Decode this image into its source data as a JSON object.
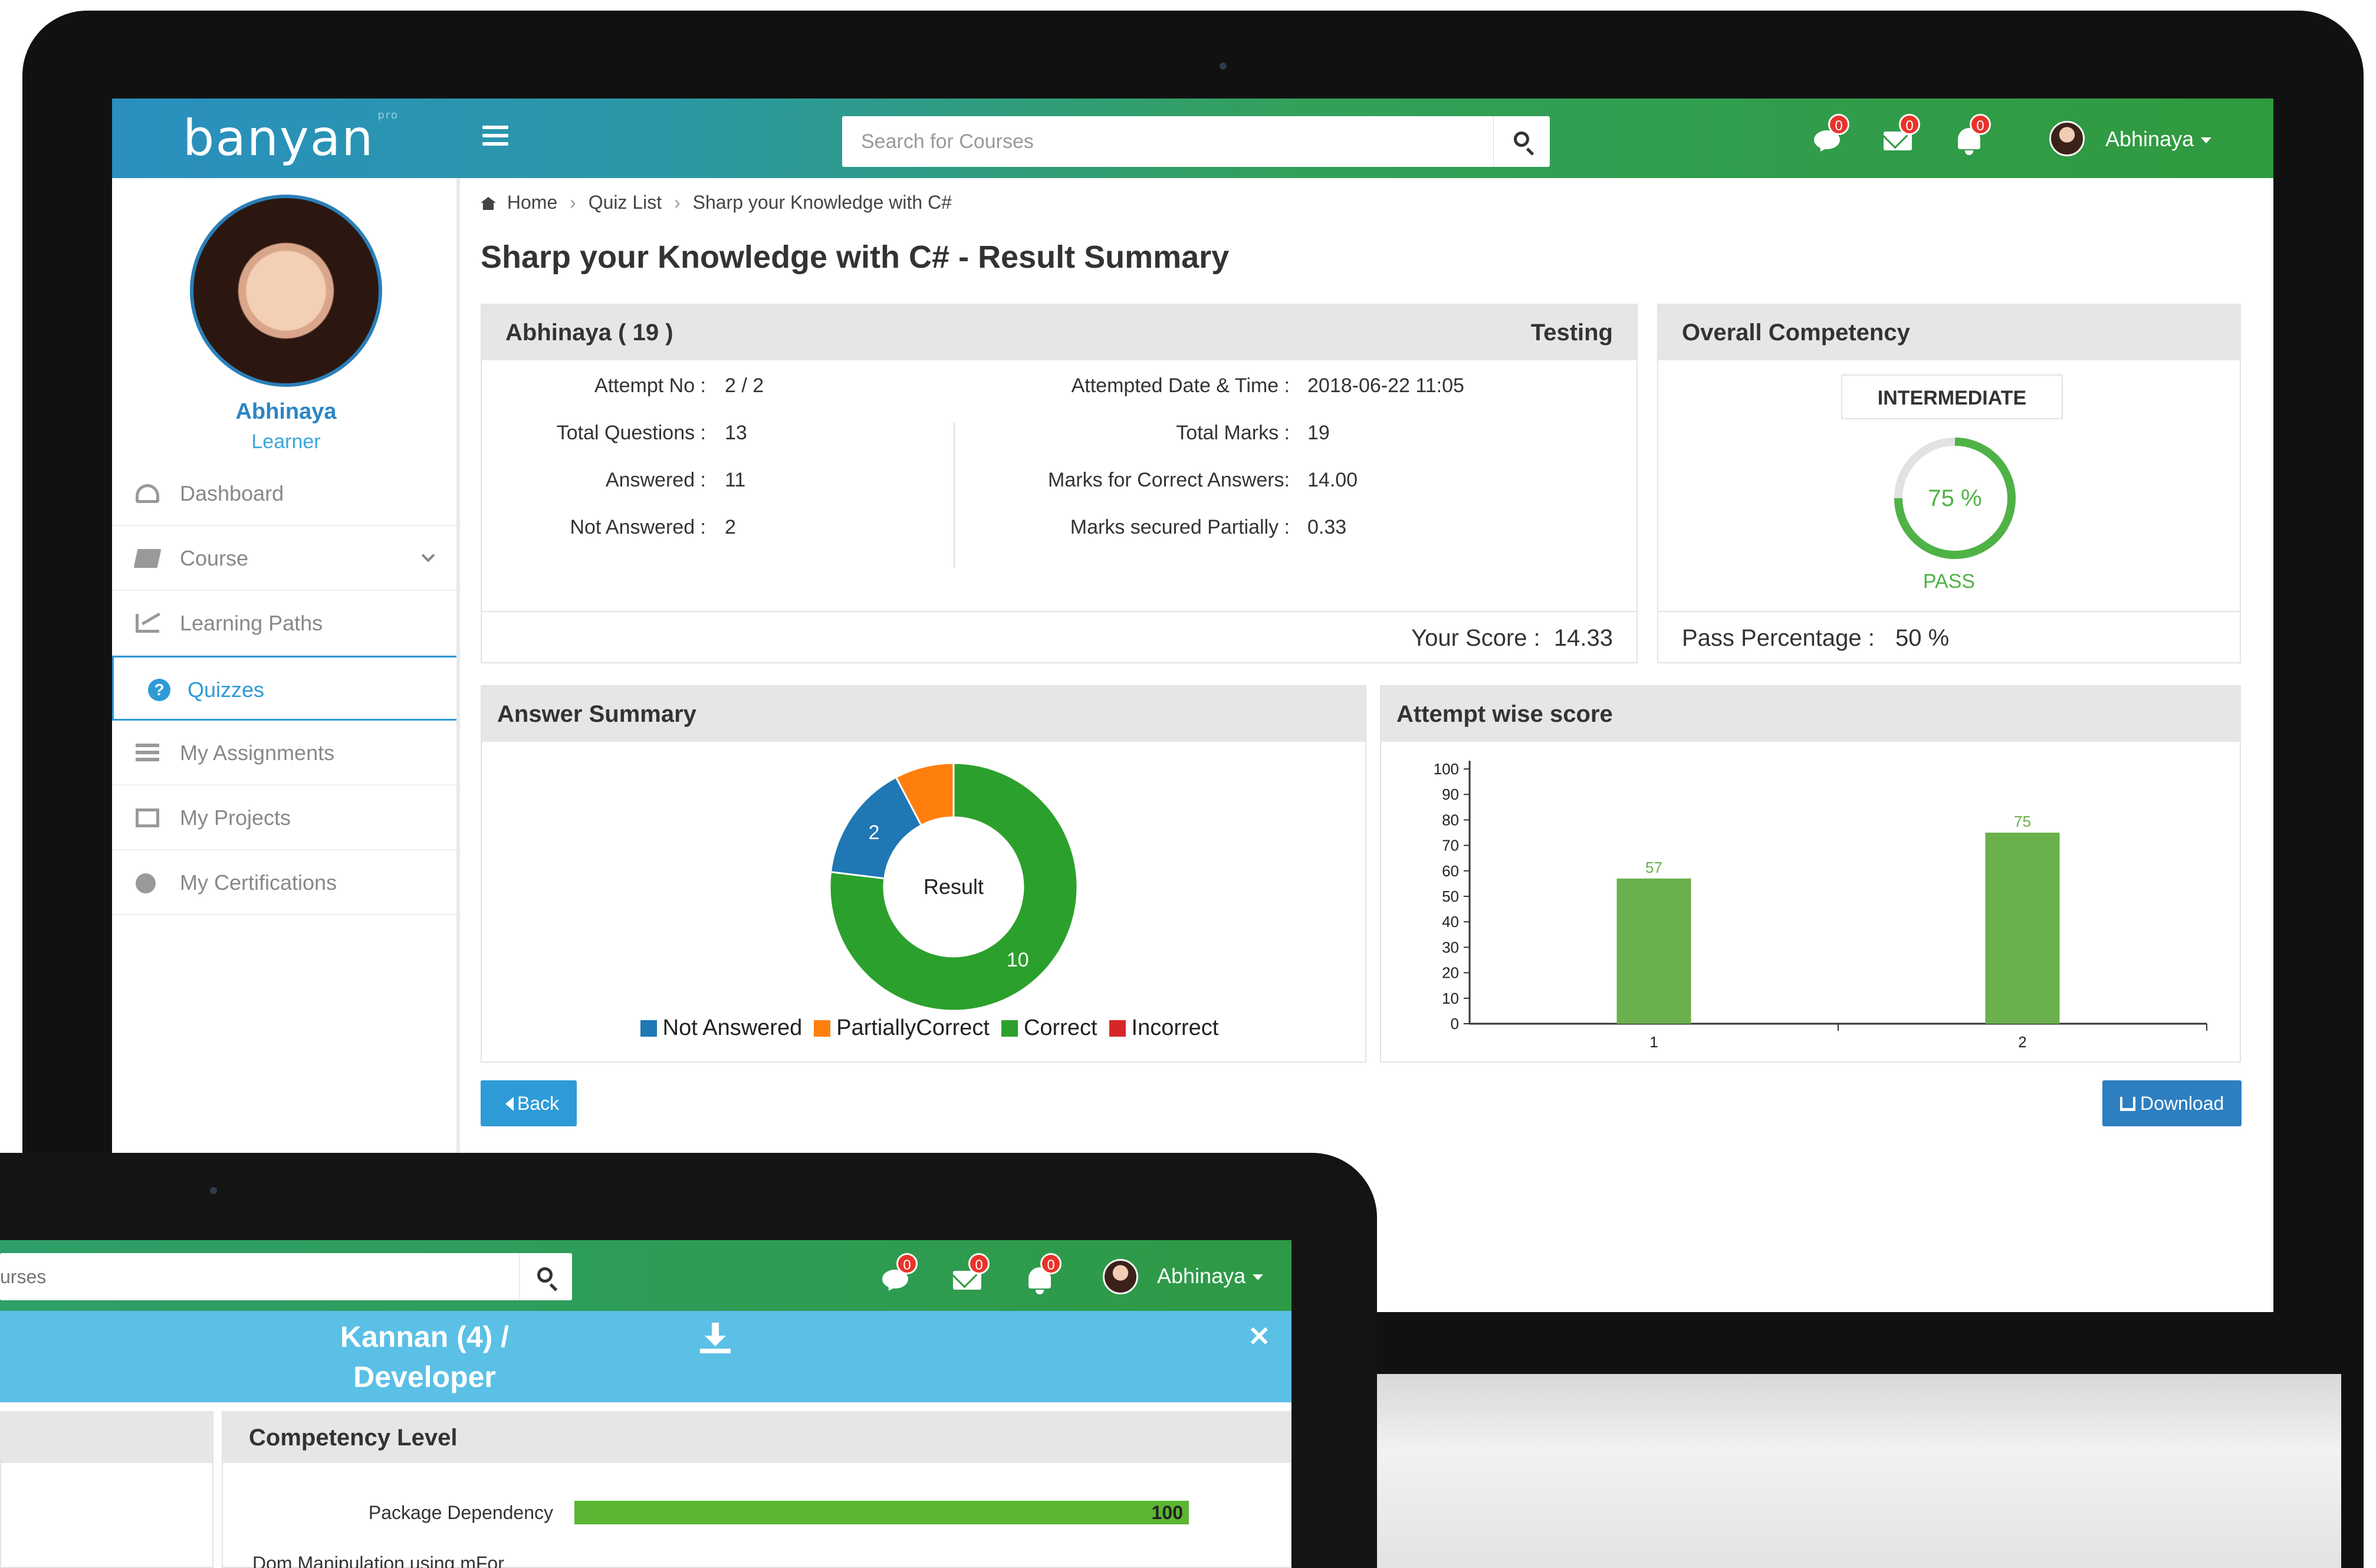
{
  "header": {
    "logo_text": "banyan",
    "logo_suffix": "pro",
    "search_placeholder": "Search for Courses",
    "notifications": [
      {
        "icon": "chat-icon",
        "count": "0"
      },
      {
        "icon": "mail-icon",
        "count": "0"
      },
      {
        "icon": "bell-icon",
        "count": "0"
      }
    ],
    "user_name": "Abhinaya"
  },
  "sidebar": {
    "profile_name": "Abhinaya",
    "profile_role": "Learner",
    "items": [
      {
        "label": "Dashboard",
        "icon": "dashboard-icon"
      },
      {
        "label": "Course",
        "icon": "book-icon"
      },
      {
        "label": "Learning Paths",
        "icon": "line-chart-icon"
      },
      {
        "label": "Quizzes",
        "icon": "question-circle-icon",
        "active": true
      },
      {
        "label": "My Assignments",
        "icon": "list-icon"
      },
      {
        "label": "My Projects",
        "icon": "projects-icon"
      },
      {
        "label": "My Certifications",
        "icon": "certificate-icon"
      }
    ]
  },
  "breadcrumb": [
    "Home",
    "Quiz List",
    "Sharp your Knowledge with C#"
  ],
  "page_title": "Sharp your Knowledge with C# - Result Summary",
  "summary": {
    "learner": "Abhinaya ( 19 )",
    "category": "Testing",
    "left": [
      {
        "label": "Attempt No :",
        "value": "2 / 2"
      },
      {
        "label": "Total Questions :",
        "value": "13"
      },
      {
        "label": "Answered :",
        "value": "11"
      },
      {
        "label": "Not Answered :",
        "value": "2"
      }
    ],
    "right": [
      {
        "label": "Attempted Date & Time :",
        "value": "2018-06-22 11:05"
      },
      {
        "label": "Total Marks :",
        "value": "19"
      },
      {
        "label": "Marks for Correct Answers:",
        "value": "14.00"
      },
      {
        "label": "Marks secured Partially :",
        "value": "0.33"
      }
    ],
    "score_label": "Your Score :",
    "score_value": "14.33"
  },
  "competency": {
    "title": "Overall Competency",
    "level": "INTERMEDIATE",
    "percent_text": "75 %",
    "percent": 75,
    "result": "PASS",
    "pass_label": "Pass Percentage :",
    "pass_value": "50 %"
  },
  "answer_summary": {
    "title": "Answer Summary",
    "center_label": "Result"
  },
  "attempt_score": {
    "title": "Attempt wise score"
  },
  "buttons": {
    "back": "Back",
    "download": "Download"
  },
  "laptop": {
    "search_placeholder": "urses",
    "notifications": [
      "0",
      "0",
      "0"
    ],
    "user_name": "Abhinaya",
    "title_line1": "Kannan (4) /",
    "title_line2": "Developer",
    "panel_title": "Competency Level",
    "rows": [
      {
        "label": "Package Dependency",
        "value": "100",
        "percent": 100
      },
      {
        "label": "Dom Manipulation using mFor",
        "value": ""
      }
    ]
  },
  "chart_data": [
    {
      "type": "pie",
      "title": "",
      "center_label": "Result",
      "categories": [
        "Not Answered",
        "PartiallyCorrect",
        "Correct",
        "Incorrect"
      ],
      "values": [
        2,
        1,
        10,
        0
      ],
      "colors": [
        "#1f77b4",
        "#ff7f0e",
        "#2ca02c",
        "#d62728"
      ],
      "data_labels": [
        "2",
        "",
        "10",
        ""
      ],
      "legend": "bottom"
    },
    {
      "type": "bar",
      "title": "",
      "categories": [
        "1",
        "2"
      ],
      "values": [
        57,
        75
      ],
      "color": "#6ab04c",
      "ylim": [
        0,
        100
      ],
      "yticks": [
        0,
        10,
        20,
        30,
        40,
        50,
        60,
        70,
        80,
        90,
        100
      ],
      "grid": false
    }
  ]
}
